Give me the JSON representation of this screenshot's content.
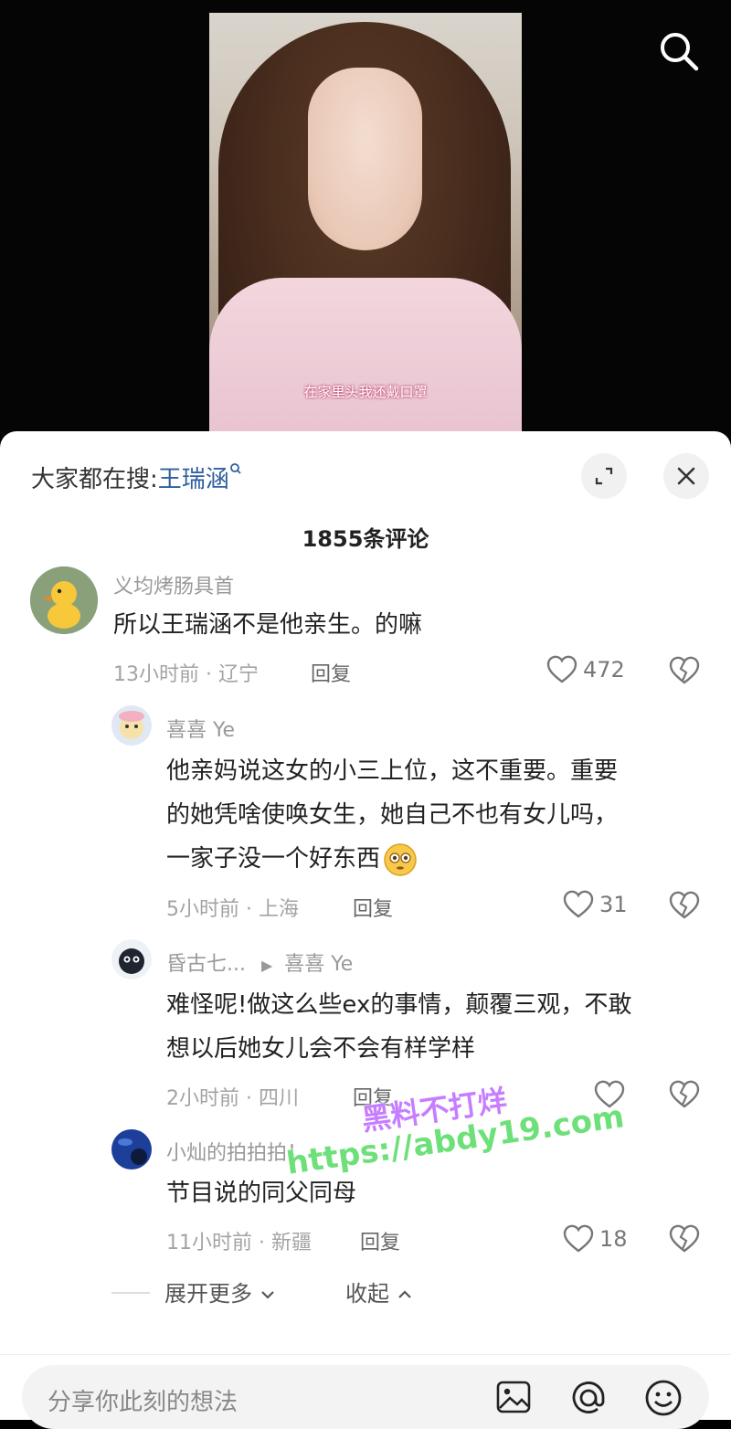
{
  "video": {
    "subtitle": "在家里头我还戴口罩"
  },
  "trending": {
    "prefix": "大家都在搜:",
    "keyword": "王瑞涵"
  },
  "comments_header": {
    "count": "1855条评论"
  },
  "comments": [
    {
      "username": "义均烤肠具首",
      "text": "所以王瑞涵不是他亲生。的嘛",
      "meta": "13小时前 · 辽宁",
      "reply": "回复",
      "likes": "472"
    },
    {
      "username": "喜喜 Ye",
      "text_lines": [
        "他亲妈说这女的小三上位，这不重要。重要",
        "的她凭啥使唤女生，她自己不也有女儿吗，",
        "一家子没一个好东西"
      ],
      "meta": "5小时前 · 上海",
      "reply": "回复",
      "likes": "31"
    },
    {
      "username": "昏古七...",
      "reply_to": "喜喜 Ye",
      "text_lines": [
        "难怪呢!做这么些ex的事情，颠覆三观，不敢",
        "想以后她女儿会不会有样学样"
      ],
      "meta": "2小时前 · 四川",
      "reply": "回复",
      "likes": ""
    },
    {
      "username": "小灿的拍拍拍！",
      "text": "节目说的同父同母",
      "meta": "11小时前 · 新疆",
      "reply": "回复",
      "likes": "18"
    }
  ],
  "thread_controls": {
    "expand": "展开更多",
    "collapse": "收起"
  },
  "composer": {
    "placeholder": "分享你此刻的想法"
  },
  "watermark": {
    "line1": "黑料不打烊",
    "line2": "https://abdy19.com"
  }
}
